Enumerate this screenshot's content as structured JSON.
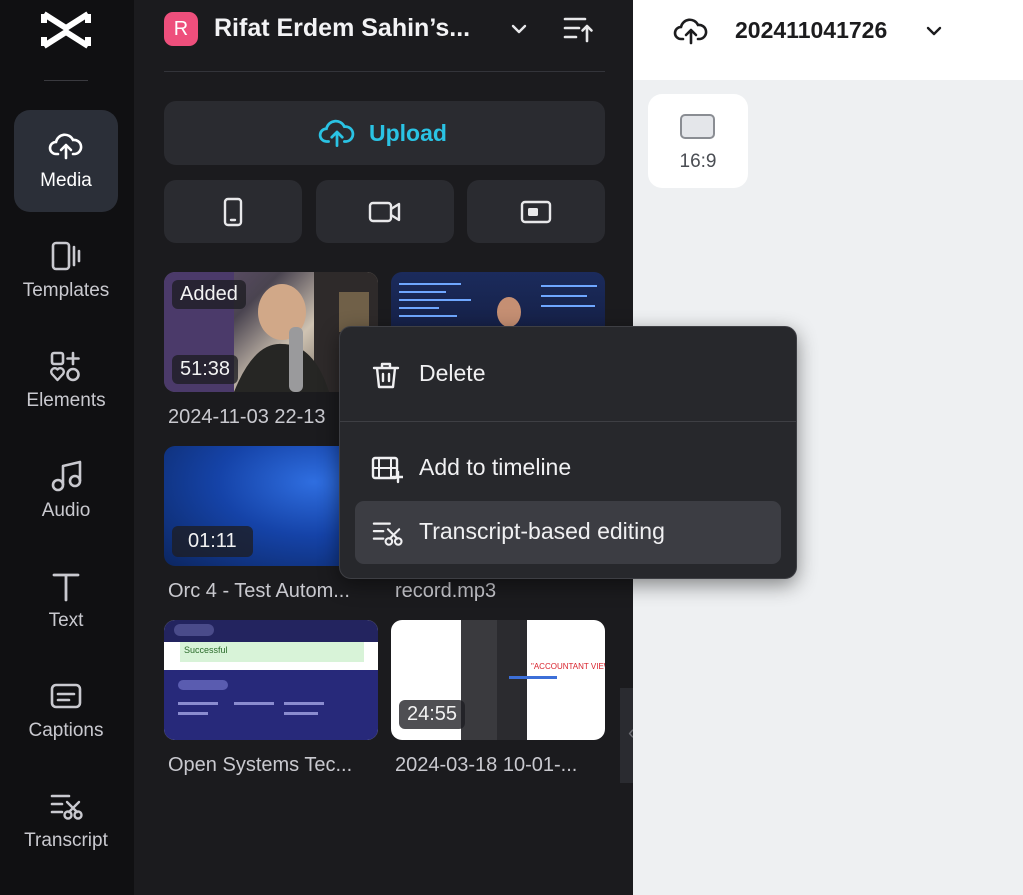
{
  "rail": {
    "items": [
      {
        "label": "Media",
        "icon": "cloud-upload-icon",
        "active": true
      },
      {
        "label": "Templates",
        "icon": "templates-icon"
      },
      {
        "label": "Elements",
        "icon": "elements-icon"
      },
      {
        "label": "Audio",
        "icon": "music-note-icon"
      },
      {
        "label": "Text",
        "icon": "text-t-icon"
      },
      {
        "label": "Captions",
        "icon": "captions-icon"
      },
      {
        "label": "Transcript",
        "icon": "transcript-icon"
      }
    ]
  },
  "workspace": {
    "avatar_letter": "R",
    "name": "Rifat Erdem Sahin’s..."
  },
  "media": {
    "upload_label": "Upload",
    "sources": [
      {
        "icon": "phone-icon"
      },
      {
        "icon": "video-camera-icon"
      },
      {
        "icon": "screen-record-icon"
      }
    ],
    "items": [
      {
        "caption": "2024-11-03 22-13",
        "duration": "51:38",
        "added_label": "Added"
      },
      {
        "caption": "",
        "duration": ""
      },
      {
        "caption": "Orc 4 - Test Autom...",
        "duration": "01:11"
      },
      {
        "caption": "record.mp3",
        "duration": ""
      },
      {
        "caption": "Open Systems Tec...",
        "duration": ""
      },
      {
        "caption": "2024-03-18 10-01-...",
        "duration": "24:55"
      }
    ],
    "thumb_texts": {
      "success_heading": "Successful",
      "accountant_view": "\"ACCOUNTANT VIEW\""
    }
  },
  "project": {
    "name": "202411041726",
    "ratio_label": "16:9"
  },
  "context_menu": {
    "items": [
      {
        "label": "Delete",
        "icon": "trash-icon"
      },
      {
        "label": "Add to timeline",
        "icon": "add-to-timeline-icon"
      },
      {
        "label": "Transcript-based editing",
        "icon": "transcript-edit-icon",
        "highlighted": true
      }
    ]
  },
  "colors": {
    "accent": "#2ac3e4",
    "avatar": "#ee4f7c",
    "panel": "#1b1b1e",
    "rail": "#101012"
  }
}
